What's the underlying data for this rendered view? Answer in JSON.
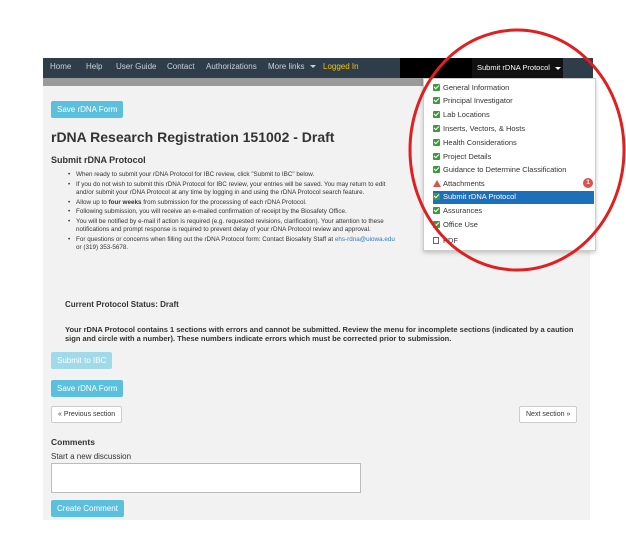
{
  "navbar": {
    "items": [
      "Home",
      "Help",
      "User Guide",
      "Contact",
      "Authorizations",
      "More links"
    ],
    "logged_in": "Logged In",
    "submit_menu": "Submit rDNA Protocol"
  },
  "page": {
    "save_button": "Save rDNA Form",
    "title": "rDNA Research Registration 151002 - Draft",
    "section_title": "Submit rDNA Protocol",
    "instructions": [
      "When ready to submit your rDNA Protocol for IBC review, click \"Submit to IBC\" below.",
      "If you do not wish to submit this rDNA Protocol for IBC review, your entries will be saved. You may return to edit and/or submit your rDNA Protocol at any time by logging in and using the rDNA Protocol search feature.",
      "Following submission, you will receive an e-mailed confirmation of receipt by the Biosafety Office.",
      "You will be notified by e-mail if action is required (e.g. requested revisions, clarification). Your attention to these notifications and prompt response is required to prevent delay of your rDNA Protocol review and approval."
    ],
    "instr_weeks_prefix": "Allow up to ",
    "instr_weeks_bold": "four weeks",
    "instr_weeks_suffix": " from submission for the processing of each rDNA Protocol.",
    "instr_contact_prefix": "For questions or concerns when filling out the rDNA Protocol form: Contact Biosafety Staff at ",
    "instr_contact_email": "ehs-rdna@uiowa.edu",
    "instr_contact_suffix": " or (319) 353-5678.",
    "status": "Current Protocol Status: Draft",
    "errors": "Your rDNA Protocol contains 1 sections with errors and cannot be submitted. Review the menu for incomplete sections (indicated by a caution sign and circle with a number). These numbers indicate errors which must be corrected prior to submission.",
    "submit_button": "Submit to IBC",
    "save_button_2": "Save rDNA Form",
    "prev_button": "« Previous section",
    "next_button": "Next section »",
    "comments_heading": "Comments",
    "discussion_label": "Start a new discussion",
    "create_comment": "Create Comment"
  },
  "dropdown": {
    "items": [
      "General Information",
      "Principal Investigator",
      "Lab Locations",
      "Inserts, Vectors, & Hosts",
      "Health Considerations",
      "Project Details",
      "Guidance to Determine Classification"
    ],
    "attachments": "Attachments",
    "attachments_errors": "1",
    "active": "Submit rDNA Protocol",
    "after": [
      "Assurances",
      "Office Use"
    ],
    "pdf": "PDF"
  },
  "colors": {
    "accent": "#5bc0de",
    "navbar": "#2f3d4a",
    "success": "#3c9a3c",
    "danger": "#d9534f",
    "active": "#1e6fba",
    "annotation_ring": "#e02020"
  }
}
